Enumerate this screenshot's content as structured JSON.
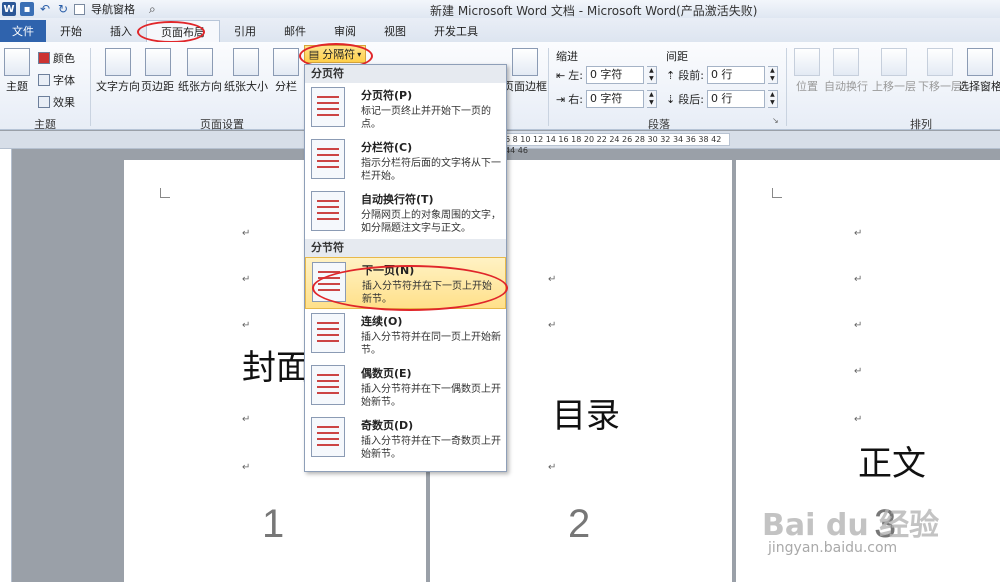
{
  "titlebar": {
    "nav_pane_label": "导航窗格",
    "title": "新建 Microsoft Word 文档 - Microsoft Word(产品激活失败)"
  },
  "tabs": [
    "文件",
    "开始",
    "插入",
    "页面布局",
    "引用",
    "邮件",
    "审阅",
    "视图",
    "开发工具"
  ],
  "ribbon": {
    "theme": "主题",
    "colors": "颜色",
    "fonts": "字体",
    "effects": "效果",
    "theme_group": "主题",
    "text_direction": "文字方向",
    "margins": "页边距",
    "orientation": "纸张方向",
    "size": "纸张大小",
    "columns": "分栏",
    "page_setup_group": "页面设置",
    "breaks": "分隔符",
    "page_borders": "页面边框",
    "indent": "缩进",
    "spacing": "间距",
    "indent_left_label": "左:",
    "indent_left_value": "0 字符",
    "indent_right_label": "右:",
    "indent_right_value": "0 字符",
    "spacing_before_label": "段前:",
    "spacing_before_value": "0 行",
    "spacing_after_label": "段后:",
    "spacing_after_value": "0 行",
    "paragraph_group": "段落",
    "position": "位置",
    "wrap": "自动换行",
    "bring_forward": "上移一层",
    "send_backward": "下移一层",
    "selection_pane": "选择窗格",
    "arrange_group": "排列"
  },
  "ruler_text": "6 8 10 12 14 16 18 20 22 24 26 28 30 32 34 36 38 42 44 46",
  "menu": {
    "page_breaks_header": "分页符",
    "section_breaks_header": "分节符",
    "items": [
      {
        "title": "分页符(P)",
        "desc": "标记一页终止并开始下一页的点。"
      },
      {
        "title": "分栏符(C)",
        "desc": "指示分栏符后面的文字将从下一栏开始。"
      },
      {
        "title": "自动换行符(T)",
        "desc": "分隔网页上的对象周围的文字，如分隔题注文字与正文。"
      },
      {
        "title": "下一页(N)",
        "desc": "插入分节符并在下一页上开始新节。"
      },
      {
        "title": "连续(O)",
        "desc": "插入分节符并在同一页上开始新节。"
      },
      {
        "title": "偶数页(E)",
        "desc": "插入分节符并在下一偶数页上开始新节。"
      },
      {
        "title": "奇数页(D)",
        "desc": "插入分节符并在下一奇数页上开始新节。"
      }
    ]
  },
  "pages": [
    {
      "heading": "封面",
      "number": "1"
    },
    {
      "heading": "目录",
      "number": "2"
    },
    {
      "heading": "正文",
      "number": "3"
    }
  ],
  "para_mark": "↵",
  "watermark": "Bai du 经验",
  "watermark_url": "jingyan.baidu.com"
}
